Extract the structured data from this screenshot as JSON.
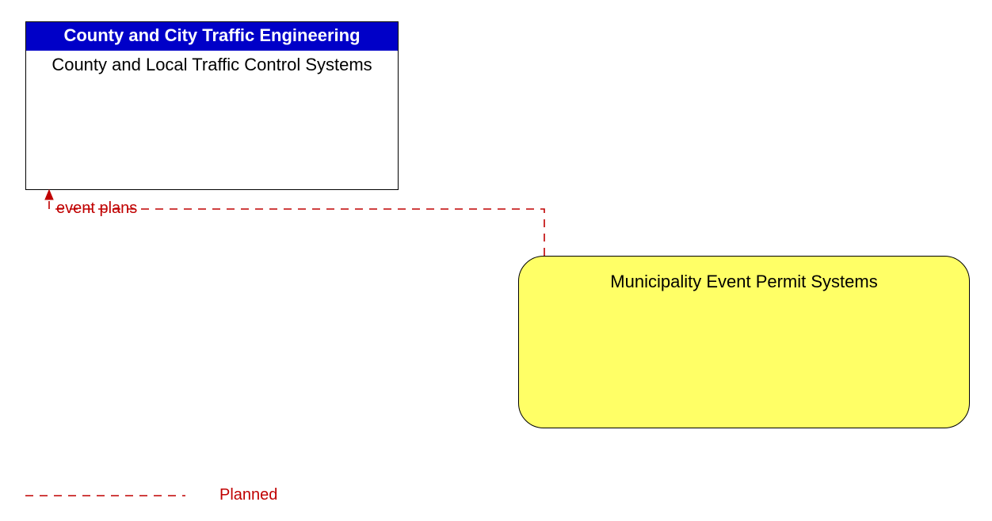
{
  "nodes": {
    "top_box": {
      "header": "County and City Traffic Engineering",
      "body": "County and Local Traffic Control Systems"
    },
    "bottom_box": {
      "title": "Municipality Event Permit Systems"
    }
  },
  "flow": {
    "label": "event plans"
  },
  "legend": {
    "planned_label": "Planned"
  },
  "colors": {
    "header_bg": "#0000c8",
    "header_text": "#ffffff",
    "planned_line": "#c00000",
    "yellow_fill": "#ffff66",
    "border": "#000000"
  }
}
